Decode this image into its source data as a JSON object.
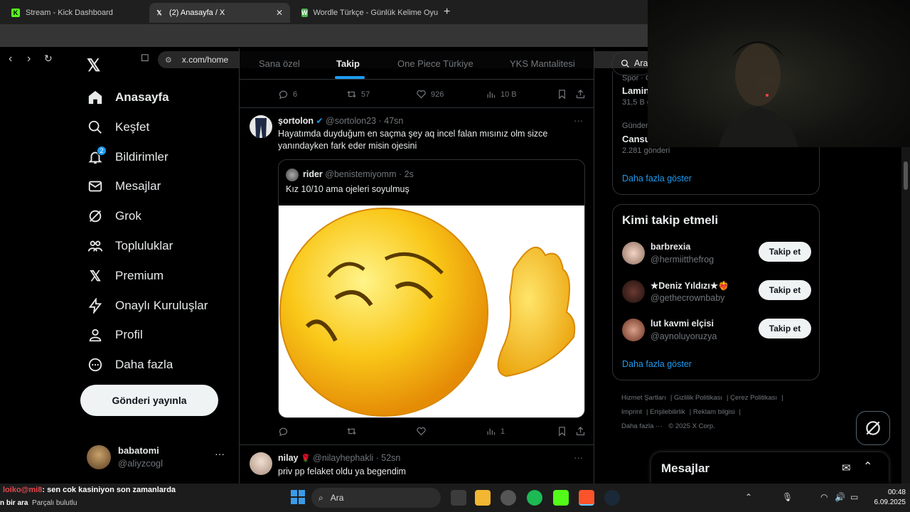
{
  "browser": {
    "tabs": [
      {
        "title": "Stream - Kick Dashboard",
        "favicon": "kick-icon",
        "color": "#53fc18"
      },
      {
        "title": "(2) Anasayfa / X",
        "favicon": "x-icon",
        "color": "#000000"
      },
      {
        "title": "Wordle Türkçe - Günlük Kelime Oyun",
        "favicon": "wordle-icon",
        "color": "#4caf50"
      }
    ],
    "url": "x.com/home"
  },
  "nav": {
    "items": [
      {
        "label": "Anasayfa",
        "icon": "home-icon",
        "active": true
      },
      {
        "label": "Keşfet",
        "icon": "search-icon"
      },
      {
        "label": "Bildirimler",
        "icon": "bell-icon",
        "badge": "2"
      },
      {
        "label": "Mesajlar",
        "icon": "mail-icon"
      },
      {
        "label": "Grok",
        "icon": "grok-icon"
      },
      {
        "label": "Topluluklar",
        "icon": "people-icon"
      },
      {
        "label": "Premium",
        "icon": "x-icon"
      },
      {
        "label": "Onaylı Kuruluşlar",
        "icon": "lightning-icon"
      },
      {
        "label": "Profil",
        "icon": "person-icon"
      },
      {
        "label": "Daha fazla",
        "icon": "more-circle-icon"
      }
    ],
    "post_button": "Gönderi yayınla",
    "account": {
      "name": "babatomi",
      "handle": "@aliyzcogl"
    }
  },
  "feed": {
    "tabs": [
      "Sana özel",
      "Takip",
      "One Piece Türkiye",
      "YKS Mantalitesi"
    ],
    "selected_tab": "Takip",
    "prev_actions": {
      "replies": "6",
      "reposts": "57",
      "likes": "926",
      "views": "10 B"
    },
    "tweet1": {
      "name": "şortolon",
      "handle": "@sortolon23",
      "time": "47sn",
      "text": "Hayatımda duyduğum en saçma şey aq incel falan mısınız olm sizce yanındayken fark eder misin ojesini",
      "quote": {
        "name": "rider",
        "handle": "@benistemiyomm",
        "time": "2s",
        "text": "Kız 10/10 ama ojeleri soyulmuş"
      },
      "actions": {
        "views": "1"
      }
    },
    "tweet2": {
      "name": "nilay",
      "handle": "@nilayhephakli",
      "time": "52sn",
      "text": "priv pp felaket oldu ya begendim"
    }
  },
  "sidebar": {
    "search_placeholder": "Ara",
    "trends": [
      {
        "meta": "Spor · Gündemde",
        "name": "Lamin",
        "count": "31,5 B gönderi"
      },
      {
        "meta": "Gündemde",
        "name": "Cansu",
        "count": "2.281 gönderi"
      }
    ],
    "trends_more": "Daha fazla göster",
    "who_to_follow": {
      "title": "Kimi takip etmeli",
      "users": [
        {
          "name": "barbrexia",
          "handle": "@hermiitthefrog",
          "button": "Takip et"
        },
        {
          "name": "★Deniz Yıldızı★❤️‍🔥",
          "handle": "@gethecrownbaby",
          "button": "Takip et"
        },
        {
          "name": "lut kavmi elçisi",
          "handle": "@aynoluyoruzya",
          "button": "Takip et"
        }
      ],
      "more": "Daha fazla göster"
    },
    "footer": [
      "Hizmet Şartları",
      "Gizlilik Politikası",
      "Çerez Politikası",
      "Imprint",
      "Erişilebilirlik",
      "Reklam bilgisi",
      "Daha fazla ···",
      "© 2025 X Corp."
    ]
  },
  "messages_bar": {
    "title": "Mesajlar"
  },
  "overlay": {
    "user": "loiko@mi8",
    "message": ": sen cok kasiniyon son zamanlarda",
    "line2": "Parçalı bulutlu",
    "line2_prefix": "n bir ara"
  },
  "taskbar": {
    "search": "Ara",
    "time": "00:48",
    "date": "6.09.2025"
  },
  "colors": {
    "accent": "#1d9bf0",
    "bg": "#000000",
    "muted": "#71767b"
  }
}
